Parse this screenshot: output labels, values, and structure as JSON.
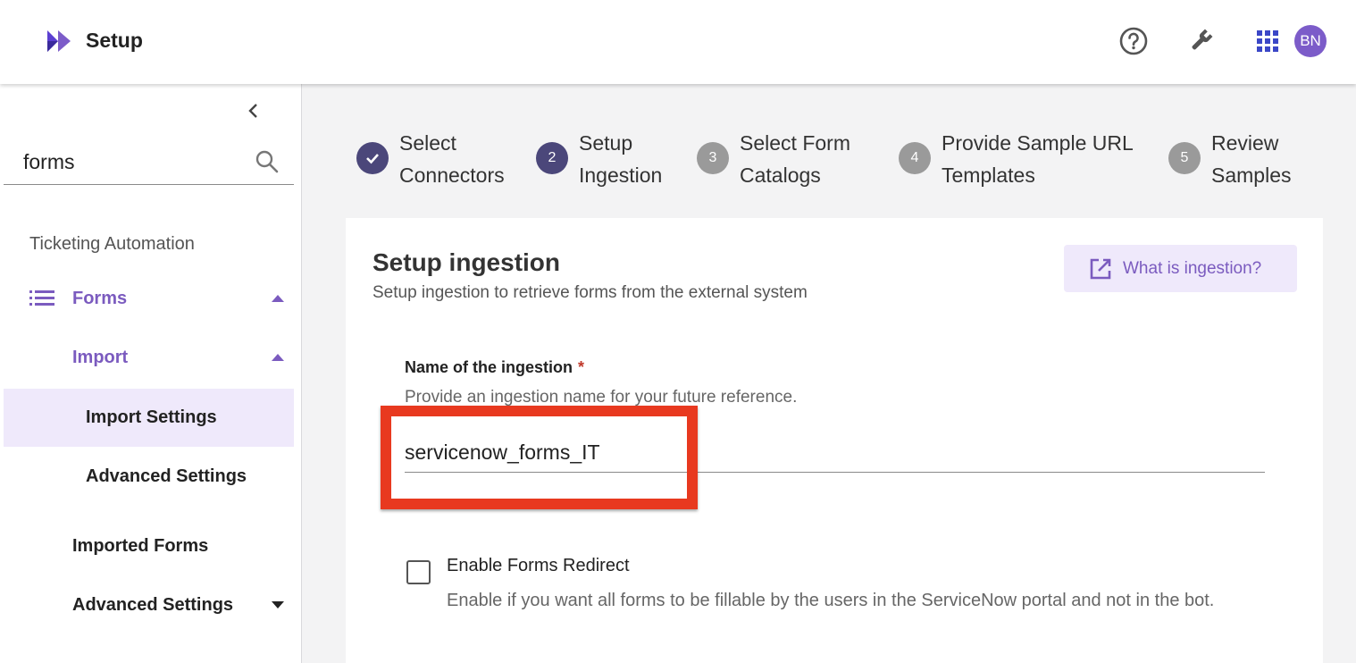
{
  "header": {
    "title": "Setup",
    "avatar_initials": "BN",
    "icons": [
      "help-icon",
      "wrench-icon",
      "apps-grid-icon"
    ],
    "brand_color": "#7c5cc9"
  },
  "sidebar": {
    "search": {
      "value": "forms",
      "placeholder": ""
    },
    "section_title": "Ticketing Automation",
    "items": [
      {
        "label": "Forms"
      },
      {
        "label": "Import"
      },
      {
        "label": "Import Settings"
      },
      {
        "label": "Advanced Settings"
      },
      {
        "label": "Imported Forms"
      },
      {
        "label": "Advanced Settings"
      }
    ]
  },
  "stepper": {
    "steps": [
      {
        "number": "1",
        "label_line1": "Select",
        "label_line2": "Connectors",
        "status": "done"
      },
      {
        "number": "2",
        "label_line1": "Setup",
        "label_line2": "Ingestion",
        "status": "active"
      },
      {
        "number": "3",
        "label_line1": "Select Form",
        "label_line2": "Catalogs",
        "status": "pending"
      },
      {
        "number": "4",
        "label_line1": "Provide Sample URL",
        "label_line2": "Templates",
        "status": "pending"
      },
      {
        "number": "5",
        "label_line1": "Review",
        "label_line2": "Samples",
        "status": "pending"
      }
    ]
  },
  "main": {
    "title": "Setup ingestion",
    "subtitle": "Setup ingestion to retrieve forms from the external system",
    "help_button": "What is ingestion?",
    "name_field": {
      "label": "Name of the ingestion",
      "required_mark": "*",
      "help": "Provide an ingestion name for your future reference.",
      "value": "servicenow_forms_IT"
    },
    "redirect": {
      "label": "Enable Forms Redirect",
      "help": "Enable if you want all forms to be fillable by the users in the ServiceNow portal and not in the bot.",
      "checked": false
    }
  }
}
